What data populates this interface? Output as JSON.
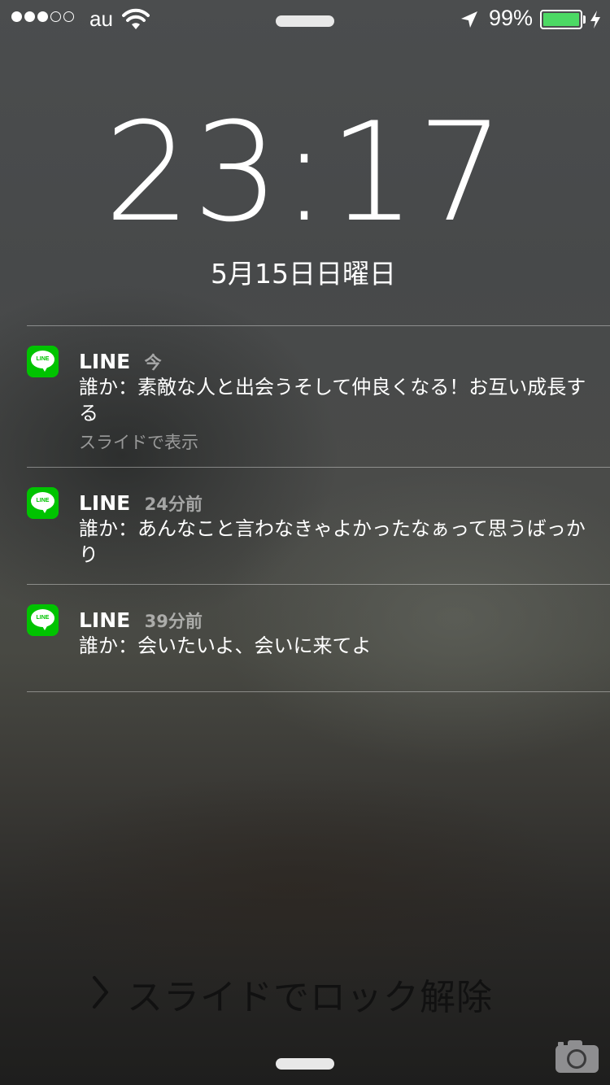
{
  "status_bar": {
    "carrier": "au",
    "signal_bars_filled": 3,
    "signal_bars_total": 5,
    "battery_percent": "99%",
    "battery_level": 0.99,
    "battery_color": "#4cd964"
  },
  "lock_screen": {
    "time": "23:17",
    "date": "5月15日日曜日"
  },
  "notifications": [
    {
      "app": "LINE",
      "time": "今",
      "message": "誰か：素敵な人と出会うそして仲良くなる！お互い成長する",
      "hint": "スライドで表示"
    },
    {
      "app": "LINE",
      "time": "24分前",
      "message": "誰か：あんなこと言わなきゃよかったなぁって思うばっかり"
    },
    {
      "app": "LINE",
      "time": "39分前",
      "message": "誰か：会いたいよ、会いに来てよ"
    }
  ],
  "app_icon": {
    "label": "LINE",
    "color": "#00c300"
  },
  "unlock": {
    "text": "スライドでロック解除"
  },
  "icons": [
    "wifi-icon",
    "location-arrow-icon",
    "charging-bolt-icon",
    "chevron-right-icon",
    "camera-icon",
    "line-app-icon"
  ]
}
